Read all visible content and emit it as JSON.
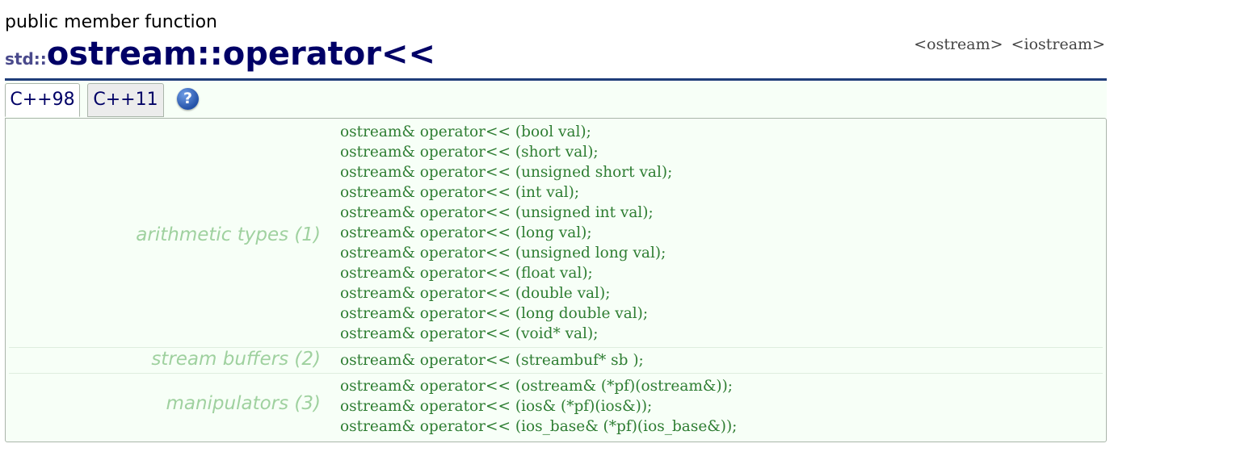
{
  "kind_label": "public member function",
  "title": {
    "namespace": "std::",
    "class_name": "ostream",
    "separator": "::",
    "member": "operator<<"
  },
  "headers": [
    "<ostream>",
    "<iostream>"
  ],
  "tabs": [
    {
      "label": "C++98",
      "active": true
    },
    {
      "label": "C++11",
      "active": false
    }
  ],
  "help_icon": "question-circle-icon",
  "groups": [
    {
      "label": "arithmetic types (1)",
      "signatures": [
        "ostream& operator<< (bool val);",
        "ostream& operator<< (short val);",
        "ostream& operator<< (unsigned short val);",
        "ostream& operator<< (int val);",
        "ostream& operator<< (unsigned int val);",
        "ostream& operator<< (long val);",
        "ostream& operator<< (unsigned long val);",
        "ostream& operator<< (float val);",
        "ostream& operator<< (double val);",
        "ostream& operator<< (long double val);",
        "ostream& operator<< (void* val);"
      ]
    },
    {
      "label": "stream buffers (2)",
      "signatures": [
        "ostream& operator<< (streambuf* sb );"
      ]
    },
    {
      "label": "manipulators (3)",
      "signatures": [
        "ostream& operator<< (ostream& (*pf)(ostream&));",
        "ostream& operator<< (ios& (*pf)(ios&));",
        "ostream& operator<< (ios_base& (*pf)(ios_base&));"
      ]
    }
  ],
  "colors": {
    "title": "#000066",
    "rule": "#1f3d7a",
    "signature": "#2e7d32",
    "group_label": "#9fd19f",
    "box_bg": "#f7fff7"
  }
}
